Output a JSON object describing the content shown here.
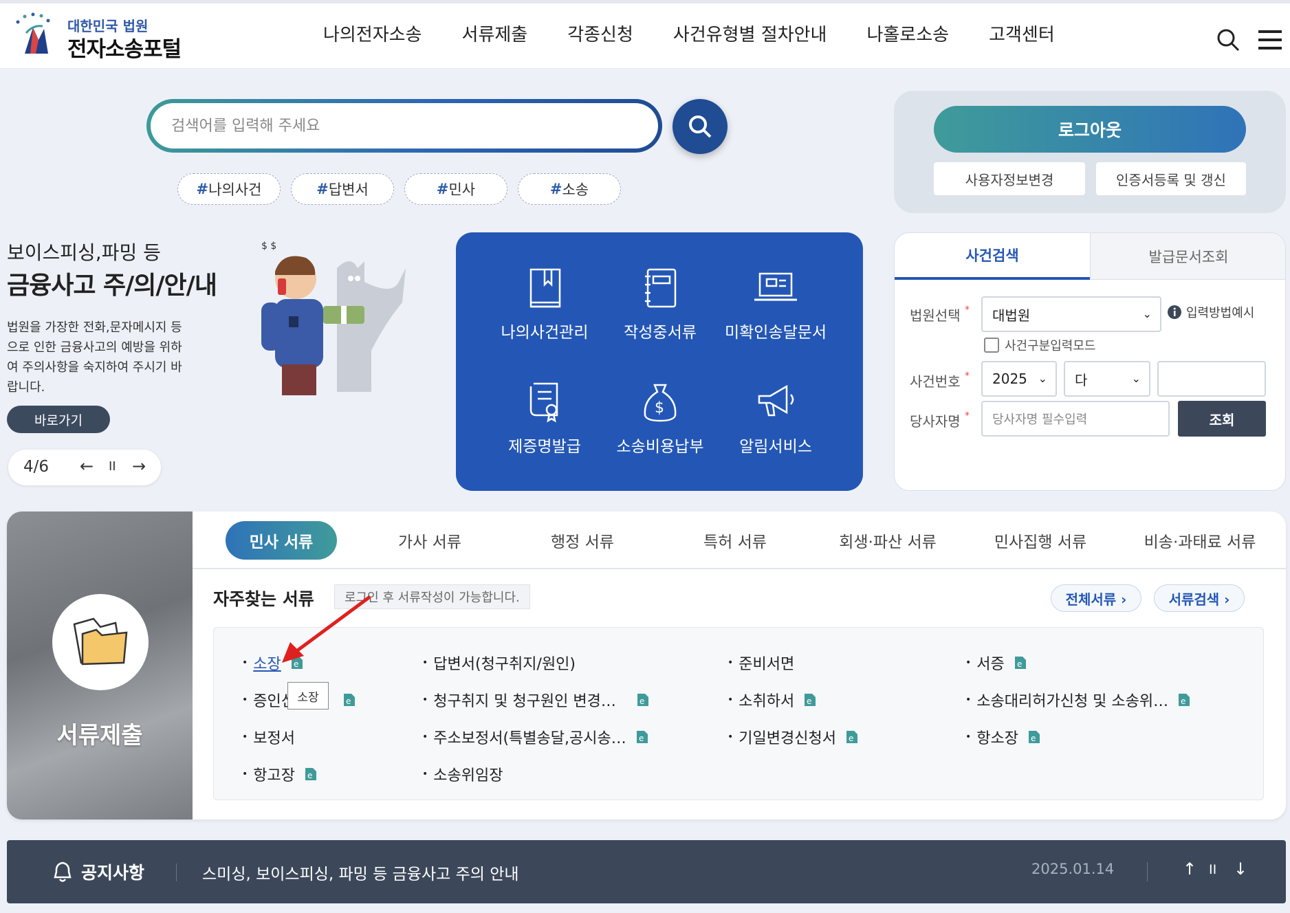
{
  "header": {
    "logo_top": "대한민국 법원",
    "logo_main": "전자소송포털",
    "nav": [
      "나의전자소송",
      "서류제출",
      "각종신청",
      "사건유형별 절차안내",
      "나홀로소송",
      "고객센터"
    ]
  },
  "search": {
    "placeholder": "검색어를 입력해 주세요",
    "tags": [
      "나의사건",
      "답변서",
      "민사",
      "소송"
    ],
    "hash": "#"
  },
  "account": {
    "logout": "로그아웃",
    "user_info": "사용자정보변경",
    "cert": "인증서등록 및 갱신"
  },
  "banner": {
    "subtitle": "보이스피싱,파밍 등",
    "title": "금융사고 주/의/안/내",
    "desc": "법원을 가장한 전화,문자메시지 등으로 인한 금융사고의 예방을 위하여 주의사항을 숙지하여 주시기 바랍니다.",
    "go": "바로가기",
    "pager": "4/6",
    "prev": "←",
    "pause": "II",
    "next": "→"
  },
  "quick": [
    "나의사건관리",
    "작성중서류",
    "미확인송달문서",
    "제증명발급",
    "소송비용납부",
    "알림서비스"
  ],
  "case_search": {
    "tab_active": "사건검색",
    "tab_other": "발급문서조회",
    "court_label": "법원선택",
    "court_value": "대법원",
    "help": "입력방법예시",
    "mode_label": "사건구분입력모드",
    "case_label": "사건번호",
    "year": "2025",
    "kind": "다",
    "party_label": "당사자명",
    "party_placeholder": "당사자명 필수입력",
    "search_btn": "조회",
    "req": "*"
  },
  "documents": {
    "left_title": "서류제출",
    "tabs": [
      "민사 서류",
      "가사 서류",
      "행정 서류",
      "특허 서류",
      "회생·파산 서류",
      "민사집행 서류",
      "비송·과태료 서류"
    ],
    "freq_title": "자주찾는 서류",
    "freq_note": "로그인 후 서류작성이 가능합니다.",
    "all_docs": "전체서류 ›",
    "doc_search": "서류검색 ›",
    "items": [
      "소장",
      "답변서(청구취지/원인)",
      "준비서면",
      "서증",
      "증인신",
      "청구취지 및 청구원인 변경…",
      "소취하서",
      "소송대리허가신청 및 소송위…",
      "보정서",
      "주소보정서(특별송달,공시송…",
      "기일변경신청서",
      "항소장",
      "항고장",
      "소송위임장"
    ],
    "tooltip": "소장"
  },
  "notice": {
    "label": "공지사항",
    "text": "스미싱, 보이스피싱, 파밍 등 금융사고 주의 안내",
    "date": "2025.01.14",
    "up": "↑",
    "pause": "II",
    "down": "↓"
  },
  "colors": {
    "primary": "#2457b5",
    "teal": "#3f9b9a",
    "dark": "#3c485a"
  }
}
